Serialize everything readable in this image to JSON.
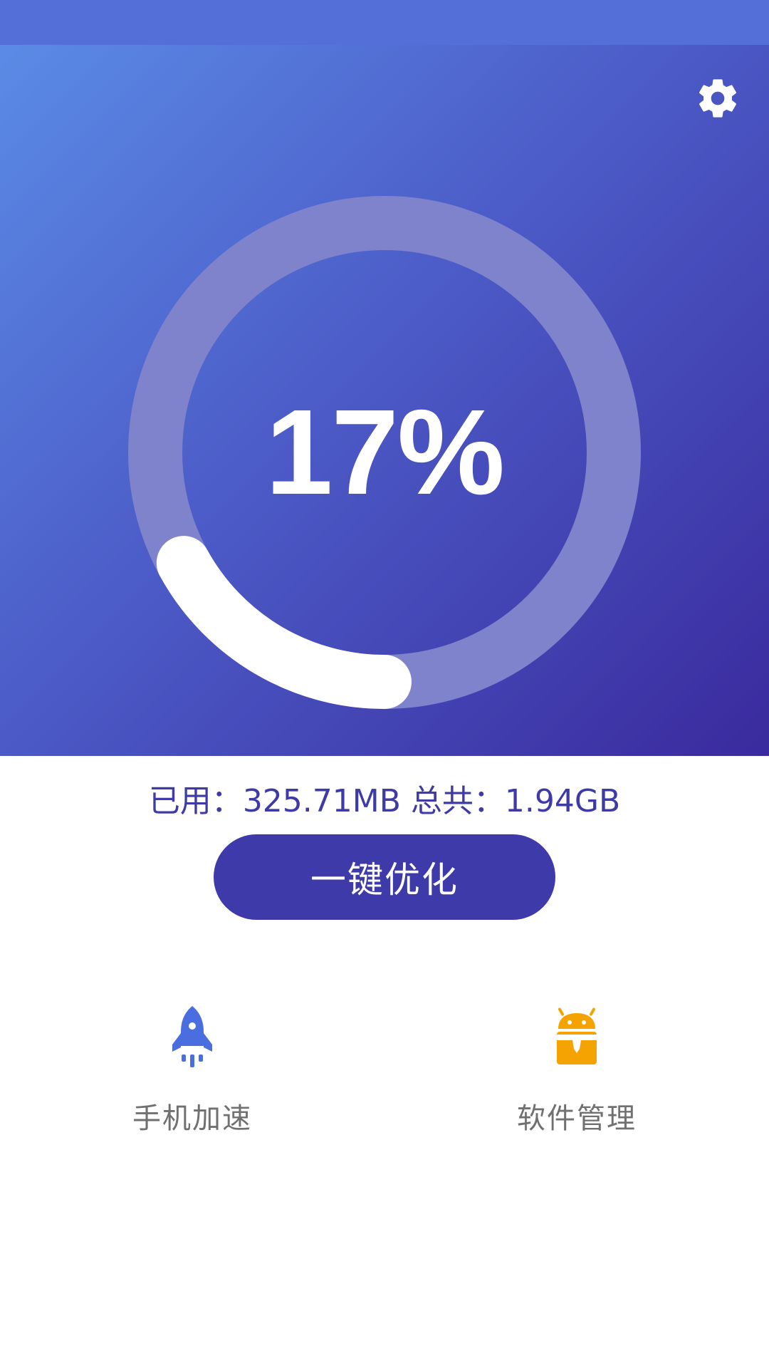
{
  "status_bar": {},
  "header": {
    "settings_icon": "gear-icon"
  },
  "gauge": {
    "value_text": "17%",
    "used_fraction": 0.17,
    "track_color": "#7f83cc",
    "progress_color": "#ffffff"
  },
  "memory": {
    "used_label": "已用：",
    "used_value": "325.71MB",
    "total_label": "总共：",
    "total_value": "1.94GB"
  },
  "actions": {
    "optimize_label": "一键优化"
  },
  "features": [
    {
      "label": "手机加速",
      "icon": "rocket-icon",
      "color": "#4a6ee0"
    },
    {
      "label": "软件管理",
      "icon": "android-box-icon",
      "color": "#f5a300"
    }
  ],
  "colors": {
    "accent": "#3f3aa9",
    "status_bar": "#5470d8"
  }
}
